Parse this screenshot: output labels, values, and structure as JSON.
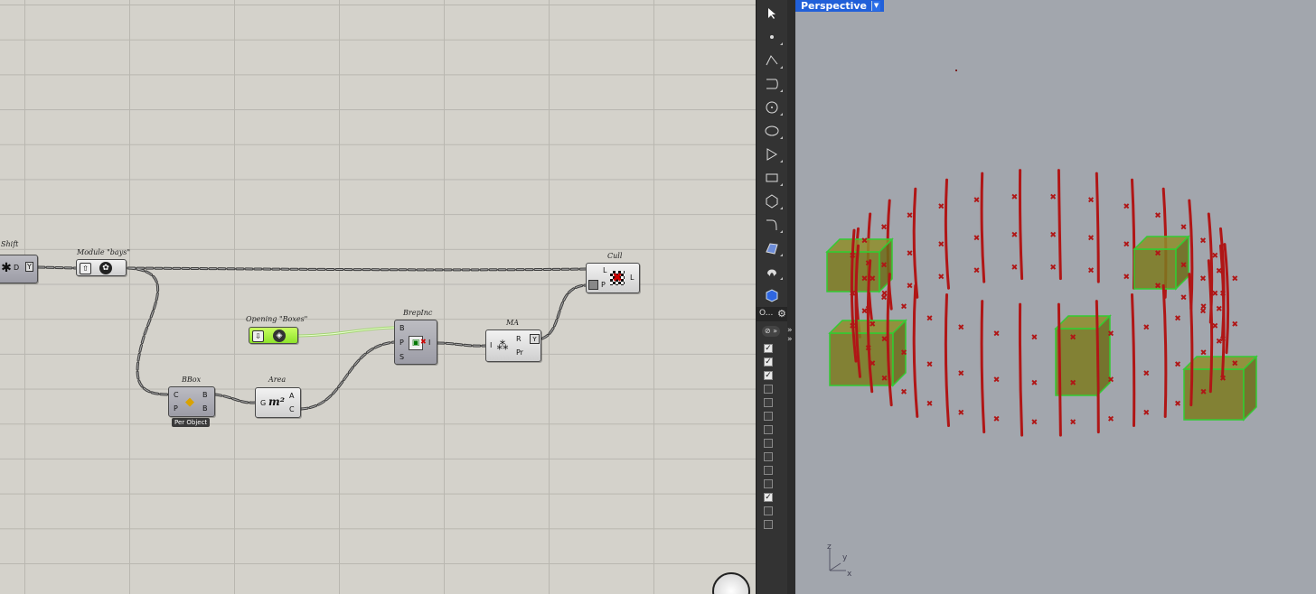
{
  "canvas": {
    "nodes": {
      "shift": {
        "name": "Shift",
        "ports": [
          "D",
          "Y"
        ]
      },
      "module_bays": {
        "name": "Module \"bays\""
      },
      "cull": {
        "name": "Cull",
        "inputs": [
          "L",
          "P"
        ],
        "outputs": [
          "L"
        ]
      },
      "opening_boxes": {
        "name": "Opening \"Boxes\""
      },
      "brepinc": {
        "name": "BrepInc",
        "inputs": [
          "B",
          "P",
          "S"
        ],
        "outputs": [
          "I"
        ]
      },
      "ma": {
        "name": "MA",
        "inputs": [
          "I"
        ],
        "outputs": [
          "R",
          "Pr"
        ]
      },
      "bbox": {
        "name": "BBox",
        "inputs": [
          "C",
          "P"
        ],
        "outputs": [
          "B",
          "B"
        ],
        "tag": "Per Object"
      },
      "area": {
        "name": "Area",
        "inputs": [
          "G"
        ],
        "outputs": [
          "A",
          "C"
        ],
        "icon_text": "m²"
      }
    }
  },
  "toolbar": {
    "tools": [
      "select-arrow-icon",
      "point-icon",
      "polyline-icon",
      "curve-icon",
      "circle-icon",
      "ellipse-icon",
      "polygon-tool-icon",
      "rectangle-icon",
      "polygon-icon",
      "fillet-icon",
      "surface-icon",
      "extrude-icon",
      "box-solid-icon"
    ],
    "layer_label": "O...",
    "layer_toggles": [
      true,
      true,
      true,
      false,
      false,
      false,
      false,
      false,
      false,
      false,
      false,
      true,
      false,
      false
    ]
  },
  "viewport": {
    "title": "Perspective",
    "axes": {
      "z": "z",
      "y": "y",
      "x": "x"
    },
    "colors": {
      "lines": "#b01616",
      "boxes": "#7c7a1e",
      "background": "#a2a6ad",
      "tab": "#2160d9"
    }
  }
}
